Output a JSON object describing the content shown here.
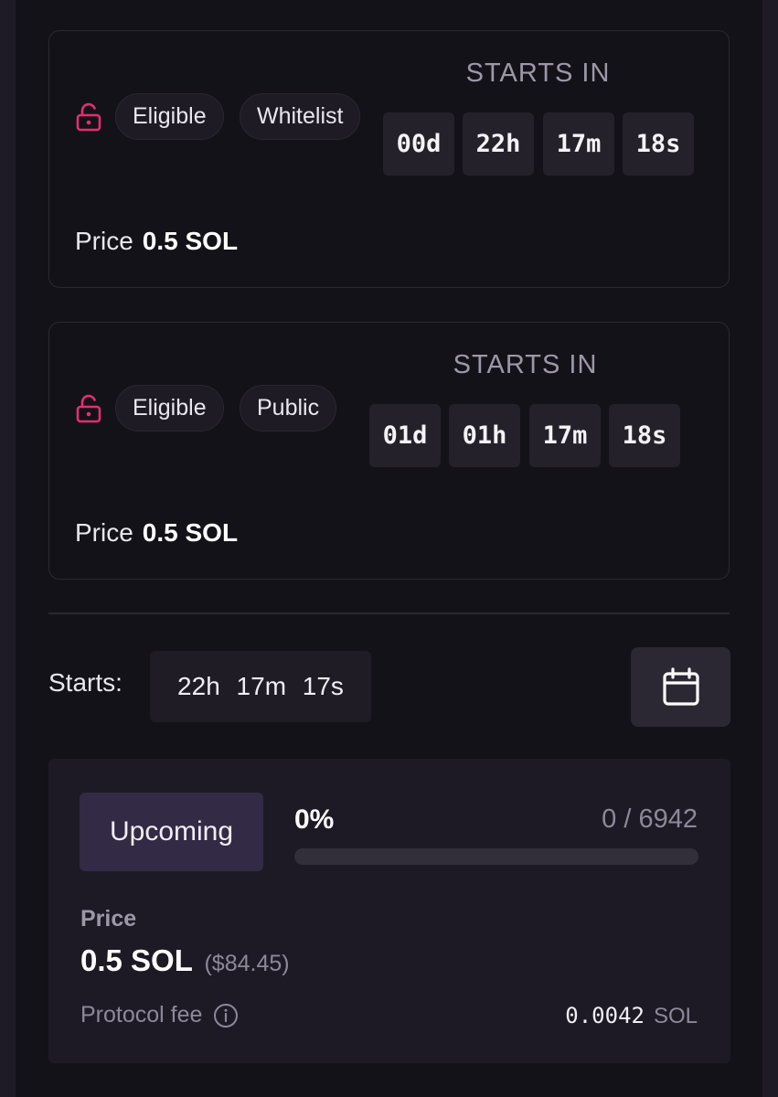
{
  "phases": [
    {
      "badges": [
        "Eligible",
        "Whitelist"
      ],
      "starts_label": "STARTS IN",
      "countdown": [
        "00d",
        "22h",
        "17m",
        "18s"
      ],
      "price_label": "Price",
      "price_value": "0.5 SOL"
    },
    {
      "badges": [
        "Eligible",
        "Public"
      ],
      "starts_label": "STARTS IN",
      "countdown": [
        "01d",
        "01h",
        "17m",
        "18s"
      ],
      "price_label": "Price",
      "price_value": "0.5 SOL"
    }
  ],
  "starts": {
    "label": "Starts:",
    "value": "22h  17m  17s"
  },
  "mint": {
    "status": "Upcoming",
    "percent": "0%",
    "progress_fraction": 0,
    "supply": "0 / 6942",
    "price_label": "Price",
    "price_value": "0.5 SOL",
    "price_usd": "($84.45)",
    "fee_label": "Protocol fee",
    "fee_value": "0.0042",
    "fee_unit": "SOL"
  },
  "colors": {
    "lock_accent": "#e0306f",
    "background": "#141219",
    "status_badge": "#332a45"
  },
  "icons": {
    "lock": "lock-open-icon",
    "calendar": "calendar-icon",
    "info": "info-icon"
  }
}
